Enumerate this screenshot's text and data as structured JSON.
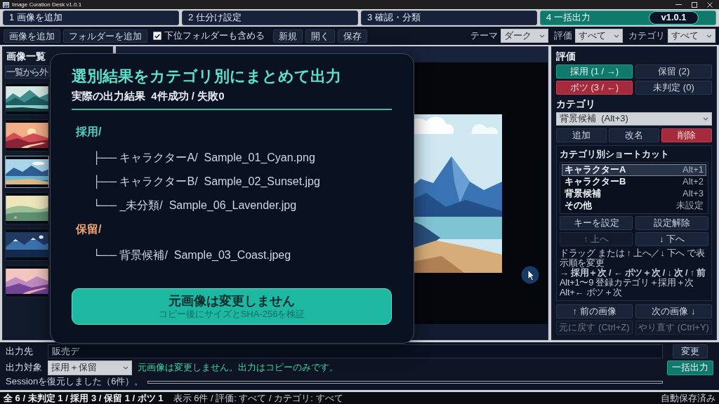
{
  "window": {
    "title": "Image Curation Desk v1.0.1"
  },
  "steps": [
    {
      "label": "1 画像を追加",
      "selected": false
    },
    {
      "label": "2 仕分け設定",
      "selected": false
    },
    {
      "label": "3 確認・分類",
      "selected": false
    },
    {
      "label": "4 一括出力",
      "selected": true
    }
  ],
  "version_badge": "v1.0.1",
  "toolbar": {
    "buttons": [
      "画像を追加",
      "フォルダーを追加"
    ],
    "include_subfolders": {
      "label": "下位フォルダーも含める",
      "checked": true
    },
    "file_buttons": [
      "新規",
      "開く",
      "保存"
    ],
    "filters": [
      {
        "label": "テーマ",
        "value": "ダーク"
      },
      {
        "label": "評価",
        "value": "すべて"
      },
      {
        "label": "カテゴリ",
        "value": "すべて"
      }
    ]
  },
  "image_list": {
    "title": "画像一覧",
    "remove_button": "一覧から外",
    "thumbnails": [
      {
        "kind": "mountain-lake",
        "selected": false
      },
      {
        "kind": "sunset",
        "selected": false
      },
      {
        "kind": "coast",
        "selected": true
      },
      {
        "kind": "hills",
        "selected": false
      },
      {
        "kind": "night",
        "selected": false
      },
      {
        "kind": "lavender",
        "selected": false
      }
    ]
  },
  "rating": {
    "title": "評価",
    "buttons": [
      {
        "label": "採用 (1 / →)",
        "kind": "adopt"
      },
      {
        "label": "保留 (2)",
        "kind": "hold"
      },
      {
        "label": "ボツ (3 / ←)",
        "kind": "reject"
      },
      {
        "label": "未判定 (0)",
        "kind": "undecided"
      }
    ]
  },
  "category": {
    "title": "カテゴリ",
    "current": "背景候補  (Alt+3)",
    "buttons": [
      {
        "label": "追加",
        "kind": "normal"
      },
      {
        "label": "改名",
        "kind": "normal"
      },
      {
        "label": "削除",
        "kind": "danger"
      }
    ],
    "shortcuts": {
      "title": "カテゴリ別ショートカット",
      "items": [
        {
          "name": "キャラクターA",
          "key": "Alt+1",
          "selected": true
        },
        {
          "name": "キャラクターB",
          "key": "Alt+2",
          "selected": false
        },
        {
          "name": "背景候補",
          "key": "Alt+3",
          "selected": false
        },
        {
          "name": "その他",
          "key": "未設定",
          "selected": false
        }
      ],
      "buttons": [
        {
          "label": "キーを設定",
          "disabled": false
        },
        {
          "label": "設定解除",
          "disabled": false
        },
        {
          "label": "↑ 上へ",
          "disabled": true
        },
        {
          "label": "↓ 下へ",
          "disabled": false
        }
      ],
      "help": [
        {
          "text": "ドラッグ または ↑ 上へ／↓ 下へ で表示順を変更",
          "kind": "plain"
        },
        {
          "text": "→ 採用＋次 / ← ボツ＋次 / ↓ 次 / ↑ 前",
          "kind": "emphasis"
        },
        {
          "text": "Alt+1〜9 登録カテゴリ＋採用＋次",
          "kind": "plain"
        },
        {
          "text": "Alt+← ボツ＋次",
          "kind": "plain"
        }
      ]
    }
  },
  "navigation": [
    {
      "label": "↑ 前の画像",
      "disabled": false
    },
    {
      "label": "次の画像 ↓",
      "disabled": false
    },
    {
      "label": "元に戻す (Ctrl+Z)",
      "disabled": true
    },
    {
      "label": "やり直す (Ctrl+Y)",
      "disabled": true
    }
  ],
  "output": {
    "destination_label": "出力先",
    "destination_value": "販売デ",
    "change_button": "変更",
    "target_label": "出力対象",
    "target_value": "採用＋保留",
    "note": "元画像は変更しません。出力はコピーのみです。",
    "export_button": "一括出力",
    "session_message": "Sessionを復元しました（6件）。",
    "progress": {
      "level": 0
    }
  },
  "status_bar": {
    "counts": "全 6 / 未判定 1 / 採用 3 / 保留 1 / ボツ 1",
    "filter": "表示 6件 / 評価: すべて / カテゴリ: すべて",
    "save_state": "自動保存済み"
  },
  "dialog": {
    "title": "選別結果をカテゴリ別にまとめて出力",
    "subtitle": "実際の出力結果  4件成功 / 失敗0",
    "tree": [
      {
        "label": "採用/",
        "color": "#4fd1c5",
        "children": [
          {
            "label": "├── キャラクターA/  Sample_01_Cyan.png"
          },
          {
            "label": "├── キャラクターB/  Sample_02_Sunset.jpg"
          },
          {
            "label": "└── _未分類/  Sample_06_Lavender.jpg"
          }
        ]
      },
      {
        "label": "保留/",
        "color": "#f4a46a",
        "children": [
          {
            "label": "└── 背景候補/  Sample_03_Coast.jpeg"
          }
        ]
      }
    ],
    "notice": {
      "title": "元画像は変更しません",
      "detail": "コピー後にサイズとSHA-256を検証"
    }
  }
}
